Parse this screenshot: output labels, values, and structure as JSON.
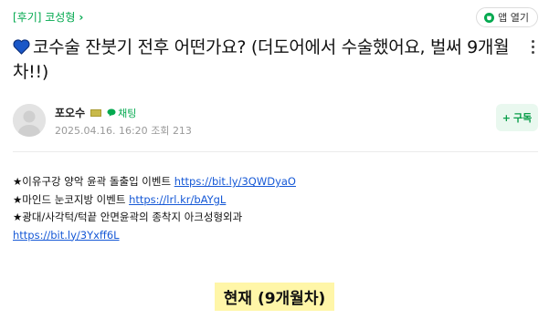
{
  "header": {
    "cafe_link": "[후기] 코성형",
    "cafe_chevron": "›",
    "app_open_label": "앱 열기",
    "app_icon": "cup-icon"
  },
  "post": {
    "title": "코수술 잔붓기 전후 어떤가요? (더도어에서 수술했어요, 벌써 9개월차!!)",
    "heart_icon": "blue-heart-icon",
    "heart_color": "#1a57c7"
  },
  "author": {
    "nickname": "포오수",
    "chat_label": "채팅",
    "date": "2025.04.16. 16:20",
    "views_label": "조회",
    "views": "213",
    "subscribe_plus": "+",
    "subscribe_label": "구독"
  },
  "content": {
    "line1_text": "★이유구강 양악 윤곽 돌출입 이벤트 ",
    "line1_link": "https://bit.ly/3QWDyaO",
    "line2_text": "★마인드 눈코지방 이벤트 ",
    "line2_link": "https://lrl.kr/bAYgL",
    "line3_text": "★광대/사각턱/턱끝 안면윤곽의 종착지 아크성형외과",
    "line4_link": "https://bit.ly/3Yxff6L",
    "banner": "현재 (9개월차)"
  },
  "colors": {
    "brand_green": "#03a94f",
    "link_blue": "#1558d6",
    "highlight": "#fff6a8"
  }
}
